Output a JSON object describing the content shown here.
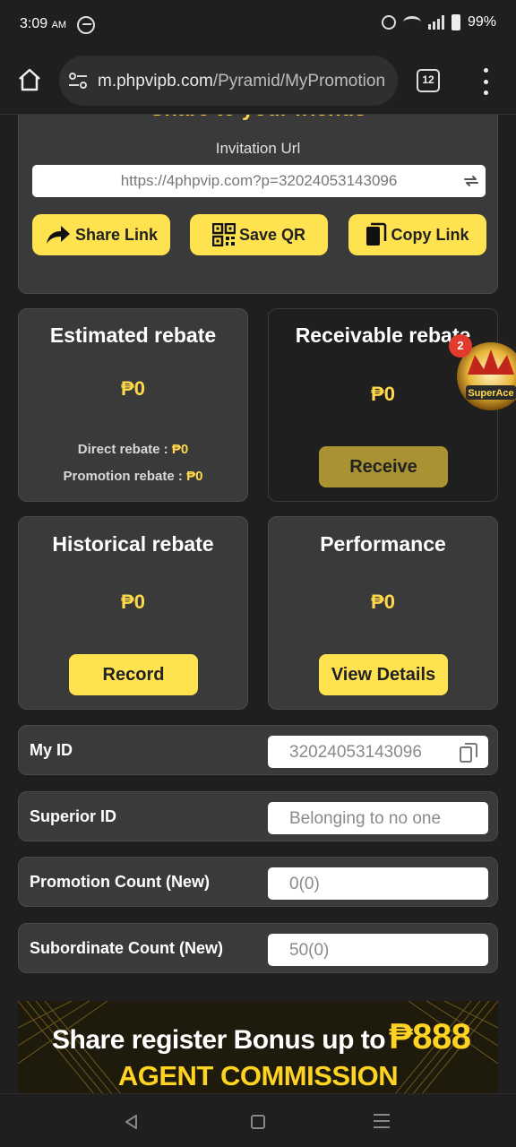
{
  "status_bar": {
    "time": "3:09",
    "ampm": "AM",
    "battery": "99%"
  },
  "browser": {
    "url_host": "m.phpvipb.com",
    "url_path": "/Pyramid/MyPromotion",
    "tab_count": "12"
  },
  "share": {
    "title": "Share to your friends",
    "invitation_label": "Invitation Url",
    "invitation_url": "https://4phpvip.com?p=32024053143096",
    "buttons": {
      "share_link": "Share Link",
      "save_qr": "Save QR",
      "copy_link": "Copy Link"
    }
  },
  "estimated": {
    "title": "Estimated rebate",
    "value": "₱0",
    "direct_label": "Direct rebate :",
    "direct_value": "₱0",
    "promotion_label": "Promotion rebate :",
    "promotion_value": "₱0"
  },
  "receivable": {
    "title": "Receivable rebate",
    "value": "₱0",
    "button": "Receive"
  },
  "historical": {
    "title": "Historical rebate",
    "value": "₱0",
    "button": "Record"
  },
  "performance": {
    "title": "Performance",
    "value": "₱0",
    "button": "View Details"
  },
  "fields": {
    "my_id": {
      "label": "My ID",
      "value": "32024053143096"
    },
    "superior_id": {
      "label": "Superior ID",
      "value": "Belonging to no one"
    },
    "promotion_count": {
      "label": "Promotion Count (New)",
      "value": "0(0)"
    },
    "subordinate_count": {
      "label": "Subordinate Count (New)",
      "value": "50(0)"
    }
  },
  "floating_badge": {
    "count": "2"
  },
  "banner": {
    "line1": "Share register Bonus up to",
    "amount": "₱888",
    "line2": "AGENT COMMISSION"
  },
  "colors": {
    "accent_yellow": "#ffe24f",
    "card_bg": "#3a3a3a",
    "page_bg": "#1f1f1f",
    "value_yellow": "#ffd94a",
    "receive_button": "#a89232"
  }
}
